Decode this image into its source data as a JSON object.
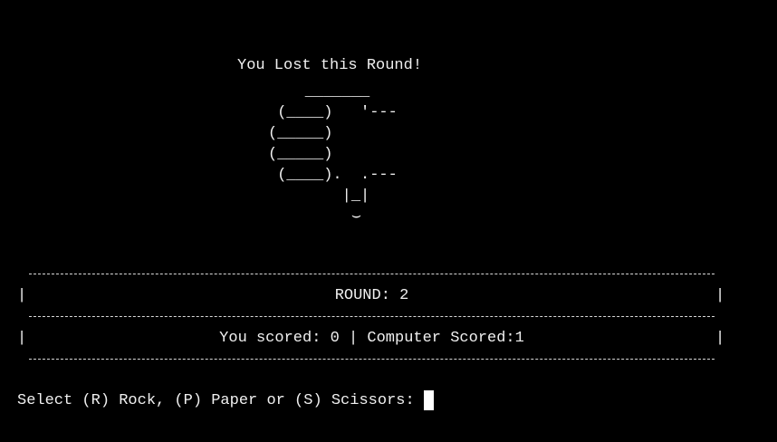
{
  "round_result": "You Lost this Round!",
  "thumbs_down_art": "    _______\n (____)   '---\n(_____)\n(_____)\n (____).  .---\n        |_|\n         ⌣",
  "scoreboard": {
    "left_border": "|",
    "right_border": "|",
    "round_label": "ROUND: 2",
    "score_label": "You scored: 0 | Computer Scored:1"
  },
  "prompt": {
    "text": "Select (R) Rock, (P) Paper or (S) Scissors:",
    "input_value": ""
  },
  "colors": {
    "background": "#000000",
    "text": "#f0f0f0",
    "cursor": "#ffffff"
  }
}
